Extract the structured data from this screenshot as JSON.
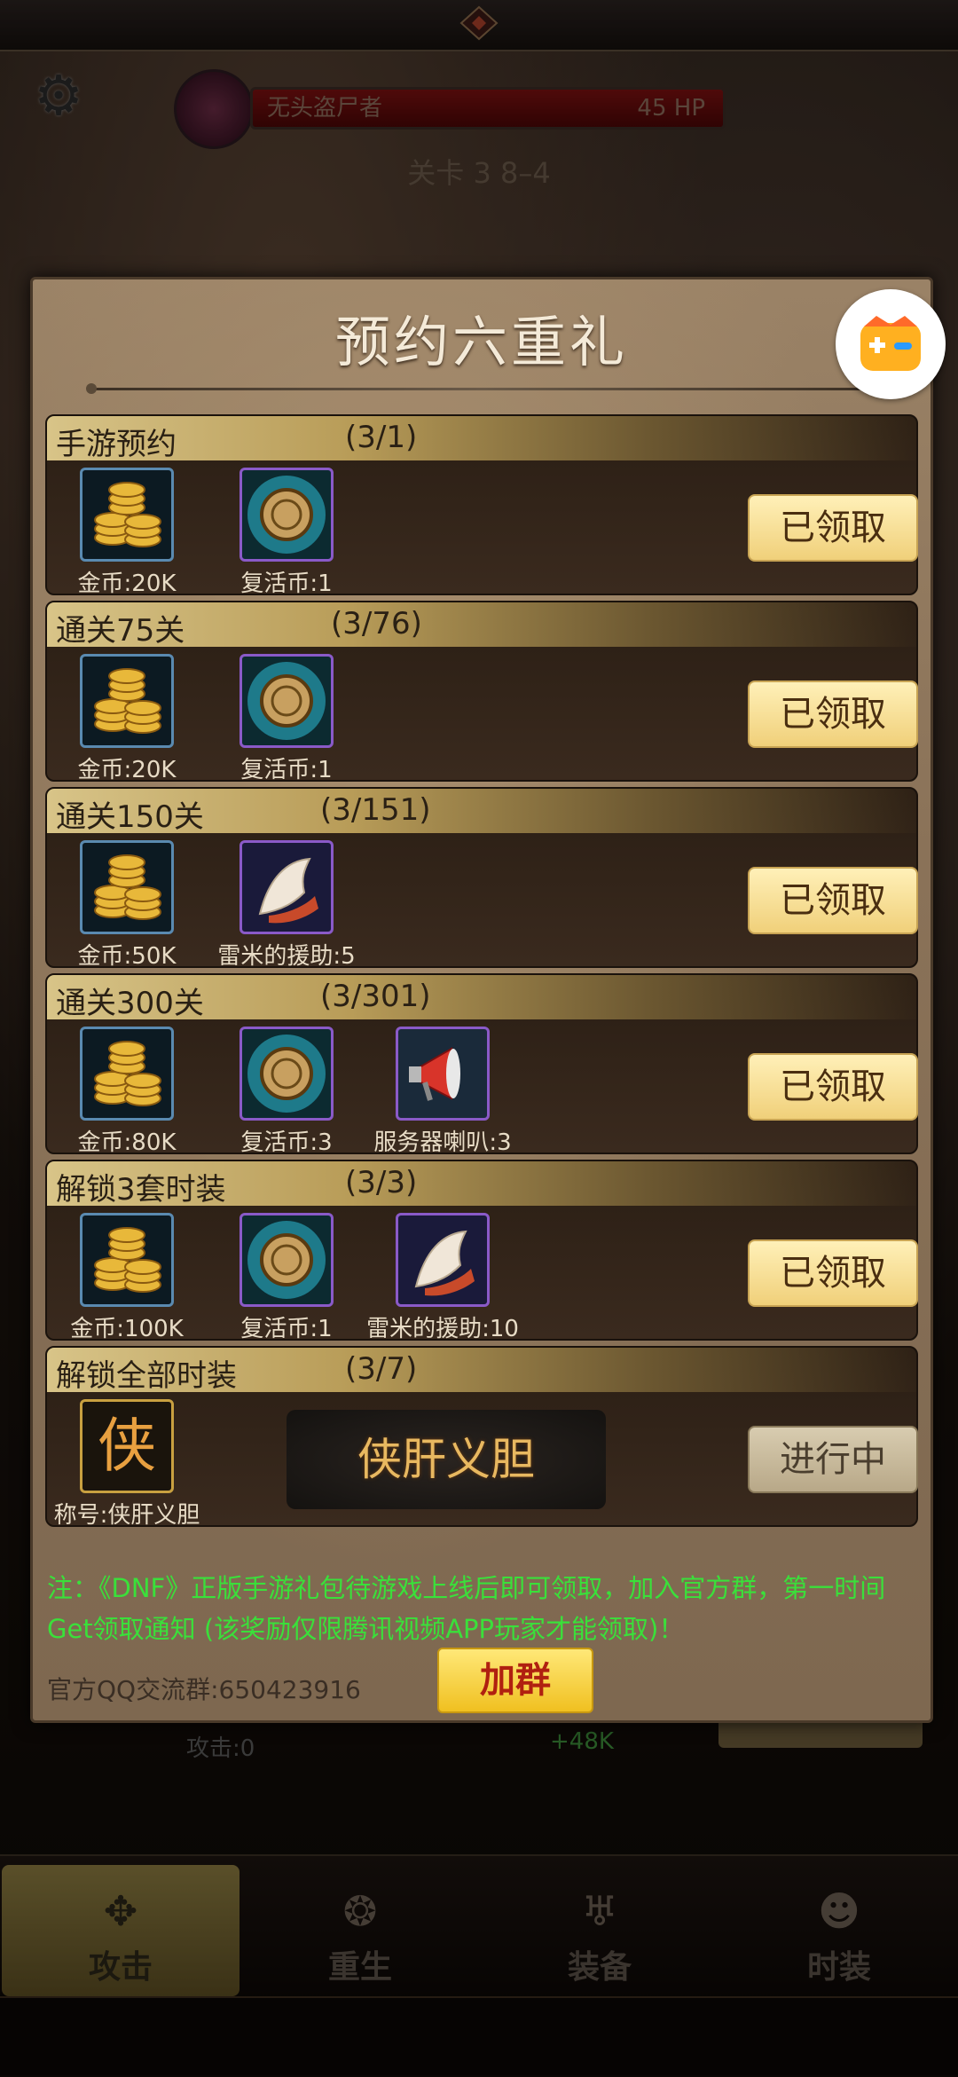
{
  "background": {
    "boss_name": "无头盗尸者",
    "boss_hp": "45  HP",
    "stage": "关卡 3     8–4",
    "attack_text": "攻击:0",
    "gain_text": "+48K"
  },
  "bottom_nav": [
    {
      "label": "攻击",
      "icon": "attack-icon",
      "active": true
    },
    {
      "label": "重生",
      "icon": "rebirth-icon",
      "active": false
    },
    {
      "label": "装备",
      "icon": "equipment-icon",
      "active": false
    },
    {
      "label": "时装",
      "icon": "fashion-icon",
      "active": false
    }
  ],
  "modal": {
    "title": "预约六重礼",
    "rows": [
      {
        "title": "手游预约",
        "progress": "(3/1)",
        "items": [
          {
            "icon": "gold-coins-icon",
            "label": "金币:20K"
          },
          {
            "icon": "revive-coin-icon",
            "label": "复活币:1"
          }
        ],
        "button": "已领取"
      },
      {
        "title": "通关75关",
        "progress": "(3/76)",
        "items": [
          {
            "icon": "gold-coins-icon",
            "label": "金币:20K"
          },
          {
            "icon": "revive-coin-icon",
            "label": "复活币:1"
          }
        ],
        "button": "已领取"
      },
      {
        "title": "通关150关",
        "progress": "(3/151)",
        "items": [
          {
            "icon": "gold-coins-icon",
            "label": "金币:50K"
          },
          {
            "icon": "glove-icon",
            "label": "雷米的援助:5"
          }
        ],
        "button": "已领取"
      },
      {
        "title": "通关300关",
        "progress": "(3/301)",
        "items": [
          {
            "icon": "gold-coins-icon",
            "label": "金币:80K"
          },
          {
            "icon": "revive-coin-icon",
            "label": "复活币:3"
          },
          {
            "icon": "megaphone-icon",
            "label": "服务器喇叭:3"
          }
        ],
        "button": "已领取"
      },
      {
        "title": "解锁3套时装",
        "progress": "(3/3)",
        "items": [
          {
            "icon": "gold-coins-icon",
            "label": "金币:100K"
          },
          {
            "icon": "revive-coin-icon",
            "label": "复活币:1"
          },
          {
            "icon": "glove-icon",
            "label": "雷米的援助:10"
          }
        ],
        "button": "已领取"
      },
      {
        "title": "解锁全部时装",
        "progress": "(3/7)",
        "items": [
          {
            "icon": "title-badge-icon",
            "label": "称号:侠肝义胆",
            "glyph": "侠"
          }
        ],
        "banner": "侠肝义胆",
        "button": "进行中"
      }
    ],
    "note": "注：《DNF》正版手游礼包待游戏上线后即可领取，加入官方群，第一时间Get领取通知 (该奖励仅限腾讯视频APP玩家才能领取)！",
    "qq_group": "官方QQ交流群:650423916",
    "join_button": "加群"
  },
  "colors": {
    "accent_gold": "#f0d07a",
    "note_green": "#3ae03a",
    "join_text": "#b02010"
  }
}
